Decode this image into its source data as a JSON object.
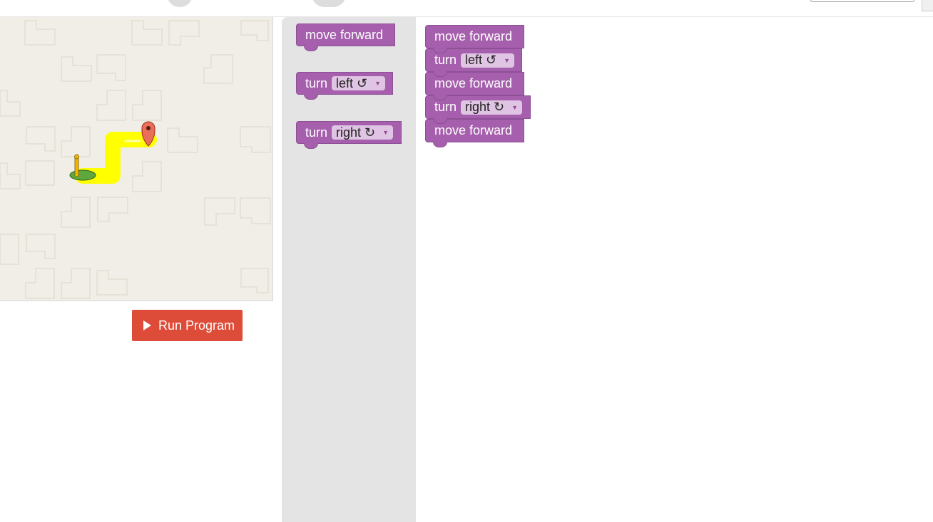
{
  "topbar": {
    "partial_text": ""
  },
  "run_button": {
    "label": "Run Program"
  },
  "toolbox": {
    "blocks": [
      {
        "text": "move forward"
      },
      {
        "keyword": "turn",
        "dropdown": "left ↺"
      },
      {
        "keyword": "turn",
        "dropdown": "right ↻"
      }
    ]
  },
  "program": {
    "blocks": [
      {
        "text": "move forward"
      },
      {
        "keyword": "turn",
        "dropdown": "left ↺"
      },
      {
        "text": "move forward"
      },
      {
        "keyword": "turn",
        "dropdown": "right ↻"
      },
      {
        "text": "move forward"
      }
    ]
  },
  "colors": {
    "block": "#a55fac",
    "run_button": "#dd4b39",
    "path": "#ffff00",
    "maze_bg": "#f1eee7"
  }
}
